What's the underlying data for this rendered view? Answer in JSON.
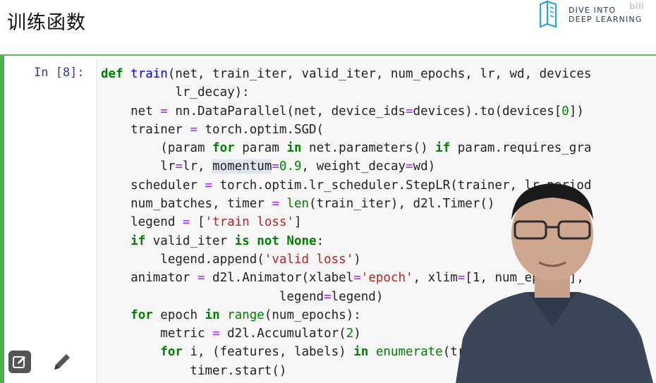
{
  "header": {
    "title": "训练函数",
    "logo_line1": "DIVE INTO",
    "logo_line2": "DEEP LEARNING",
    "corner_mark": "bili"
  },
  "cell": {
    "prompt": "In [8]:",
    "lines": [
      [
        [
          "kw",
          "def"
        ],
        [
          "t",
          " "
        ],
        [
          "fn",
          "train"
        ],
        [
          "t",
          "(net, train_iter, valid_iter, num_epochs, lr, wd, devices"
        ]
      ],
      [
        [
          "t",
          "          lr_decay):"
        ]
      ],
      [
        [
          "t",
          "    net "
        ],
        [
          "op",
          "="
        ],
        [
          "t",
          " nn.DataParallel(net, device_ids"
        ],
        [
          "op",
          "="
        ],
        [
          "t",
          "devices).to(devices["
        ],
        [
          "num",
          "0"
        ],
        [
          "t",
          "])"
        ]
      ],
      [
        [
          "t",
          "    trainer "
        ],
        [
          "op",
          "="
        ],
        [
          "t",
          " torch.optim.SGD("
        ]
      ],
      [
        [
          "t",
          "        (param "
        ],
        [
          "kw",
          "for"
        ],
        [
          "t",
          " param "
        ],
        [
          "kw",
          "in"
        ],
        [
          "t",
          " net.parameters() "
        ],
        [
          "kw",
          "if"
        ],
        [
          "t",
          " param.requires_gra"
        ]
      ],
      [
        [
          "t",
          "        lr"
        ],
        [
          "op",
          "="
        ],
        [
          "t",
          "lr, "
        ],
        [
          "hl",
          "momentum"
        ],
        [
          "op",
          "="
        ],
        [
          "num",
          "0.9"
        ],
        [
          "t",
          ", weight_decay"
        ],
        [
          "op",
          "="
        ],
        [
          "t",
          "wd)"
        ]
      ],
      [
        [
          "t",
          "    scheduler "
        ],
        [
          "op",
          "="
        ],
        [
          "t",
          " torch.optim.lr_scheduler.StepLR(trainer, lr_period"
        ]
      ],
      [
        [
          "t",
          "    num_batches, timer "
        ],
        [
          "op",
          "="
        ],
        [
          "t",
          " "
        ],
        [
          "bi",
          "len"
        ],
        [
          "t",
          "(train_iter), d2l.Timer()"
        ]
      ],
      [
        [
          "t",
          "    legend "
        ],
        [
          "op",
          "="
        ],
        [
          "t",
          " ["
        ],
        [
          "str",
          "'train loss'"
        ],
        [
          "t",
          "]"
        ]
      ],
      [
        [
          "t",
          "    "
        ],
        [
          "kw",
          "if"
        ],
        [
          "t",
          " valid_iter "
        ],
        [
          "kw",
          "is not None"
        ],
        [
          "t",
          ":"
        ]
      ],
      [
        [
          "t",
          "        legend.append("
        ],
        [
          "str",
          "'valid loss'"
        ],
        [
          "t",
          ")"
        ]
      ],
      [
        [
          "t",
          "    animator "
        ],
        [
          "op",
          "="
        ],
        [
          "t",
          " d2l.Animator(xlabel"
        ],
        [
          "op",
          "="
        ],
        [
          "str",
          "'epoch'"
        ],
        [
          "t",
          ", xlim"
        ],
        [
          "op",
          "="
        ],
        [
          "t",
          "[1, num_epochs],"
        ]
      ],
      [
        [
          "t",
          "                        legend"
        ],
        [
          "op",
          "="
        ],
        [
          "t",
          "legend)"
        ]
      ],
      [
        [
          "t",
          "    "
        ],
        [
          "kw",
          "for"
        ],
        [
          "t",
          " epoch "
        ],
        [
          "kw",
          "in"
        ],
        [
          "t",
          " "
        ],
        [
          "bi",
          "range"
        ],
        [
          "t",
          "(num_epochs):"
        ]
      ],
      [
        [
          "t",
          "        metric "
        ],
        [
          "op",
          "="
        ],
        [
          "t",
          " d2l.Accumulator("
        ],
        [
          "num",
          "2"
        ],
        [
          "t",
          ")"
        ]
      ],
      [
        [
          "t",
          "        "
        ],
        [
          "kw",
          "for"
        ],
        [
          "t",
          " i, (features, labels) "
        ],
        [
          "kw",
          "in"
        ],
        [
          "t",
          " "
        ],
        [
          "bi",
          "enumerate"
        ],
        [
          "t",
          "(train_iter):"
        ]
      ],
      [
        [
          "t",
          "            timer.start()"
        ]
      ]
    ]
  },
  "tools": {
    "edit_box_icon": "edit-box-icon",
    "pencil_icon": "pencil-icon"
  },
  "colors": {
    "cell_strip": "#4caf50",
    "prompt": "#303f9f",
    "keyword": "#008000",
    "function": "#0000ff",
    "operator": "#aa22ff",
    "string": "#ba2121"
  }
}
